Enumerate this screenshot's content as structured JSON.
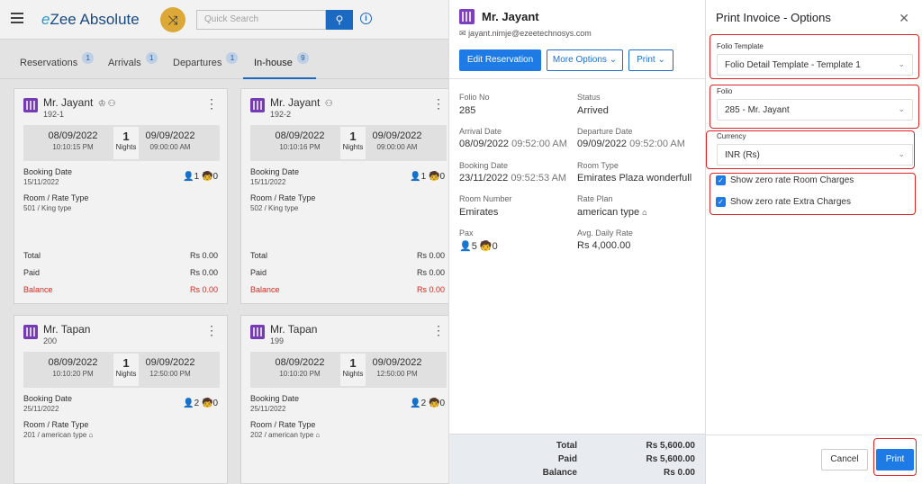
{
  "app": {
    "logo_prefix": "e",
    "logo_text": "Zee Absolute",
    "search_placeholder": "Quick Search"
  },
  "tabs": [
    {
      "label": "Reservations",
      "count": "1"
    },
    {
      "label": "Arrivals",
      "count": "1"
    },
    {
      "label": "Departures",
      "count": "1"
    },
    {
      "label": "In-house",
      "count": "9"
    }
  ],
  "cards": [
    {
      "name": "Mr. Jayant",
      "room": "192-1",
      "arr_date": "08/09/2022",
      "arr_time": "10:10:15 PM",
      "nights": "1",
      "nights_label": "Nights",
      "dep_date": "09/09/2022",
      "dep_time": "09:00:00 AM",
      "booking_label": "Booking Date",
      "booking_date": "15/11/2022",
      "pax": "1",
      "child": "0",
      "rate_label": "Room / Rate Type",
      "rate_type": "501 / King type",
      "total_label": "Total",
      "total": "Rs 0.00",
      "paid_label": "Paid",
      "paid": "Rs 0.00",
      "balance_label": "Balance",
      "balance": "Rs 0.00"
    },
    {
      "name": "Mr. Jayant",
      "room": "192-2",
      "arr_date": "08/09/2022",
      "arr_time": "10:10:16 PM",
      "nights": "1",
      "nights_label": "Nights",
      "dep_date": "09/09/2022",
      "dep_time": "09:00:00 AM",
      "booking_label": "Booking Date",
      "booking_date": "15/11/2022",
      "pax": "1",
      "child": "0",
      "rate_label": "Room / Rate Type",
      "rate_type": "502 / King type",
      "total_label": "Total",
      "total": "Rs 0.00",
      "paid_label": "Paid",
      "paid": "Rs 0.00",
      "balance_label": "Balance",
      "balance": "Rs 0.00"
    },
    {
      "name": "Mr. Tapan",
      "room": "200",
      "arr_date": "08/09/2022",
      "arr_time": "10:10:20 PM",
      "nights": "1",
      "nights_label": "Nights",
      "dep_date": "09/09/2022",
      "dep_time": "12:50:00 PM",
      "booking_label": "Booking Date",
      "booking_date": "25/11/2022",
      "pax": "2",
      "child": "0",
      "rate_label": "Room / Rate Type",
      "rate_type": "201 / american type"
    },
    {
      "name": "Mr. Tapan",
      "room": "199",
      "arr_date": "08/09/2022",
      "arr_time": "10:10:20 PM",
      "nights": "1",
      "nights_label": "Nights",
      "dep_date": "09/09/2022",
      "dep_time": "12:50:00 PM",
      "booking_label": "Booking Date",
      "booking_date": "25/11/2022",
      "pax": "2",
      "child": "0",
      "rate_label": "Room / Rate Type",
      "rate_type": "202 / american type"
    }
  ],
  "reservation": {
    "name": "Mr. Jayant",
    "email": "jayant.nimje@ezeetechnosys.com",
    "edit_label": "Edit Reservation",
    "more_label": "More Options",
    "print_label": "Print",
    "folio_no_label": "Folio No",
    "folio_no": "285",
    "status_label": "Status",
    "status": "Arrived",
    "arrival_label": "Arrival Date",
    "arrival_date": "08/09/2022",
    "arrival_time": "09:52:00 AM",
    "departure_label": "Departure Date",
    "departure_date": "09/09/2022",
    "departure_time": "09:52:00 AM",
    "booking_label": "Booking Date",
    "booking_date": "23/11/2022",
    "booking_time": "09:52:53 AM",
    "room_type_label": "Room Type",
    "room_type": "Emirates Plaza wonderfull",
    "room_number_label": "Room Number",
    "room_number": "Emirates",
    "rate_plan_label": "Rate Plan",
    "rate_plan": "american type",
    "pax_label": "Pax",
    "pax_adults": "5",
    "pax_children": "0",
    "adr_label": "Avg. Daily Rate",
    "adr": "Rs 4,000.00",
    "total_label": "Total",
    "total": "Rs 5,600.00",
    "paid_label": "Paid",
    "paid": "Rs 5,600.00",
    "balance_label": "Balance",
    "balance": "Rs 0.00"
  },
  "print_options": {
    "title": "Print Invoice - Options",
    "folio_template_label": "Folio Template",
    "folio_template": "Folio Detail Template - Template 1",
    "folio_label": "Folio",
    "folio": "285 - Mr. Jayant",
    "currency_label": "Currency",
    "currency": "INR (Rs)",
    "zero_room_label": "Show zero rate Room Charges",
    "zero_room_checked": true,
    "zero_extra_label": "Show zero rate Extra Charges",
    "zero_extra_checked": true,
    "cancel_label": "Cancel",
    "print_label": "Print"
  },
  "colors": {
    "primary": "#1e7be6",
    "highlight_frame": "#e02424",
    "balance_red": "#d93025",
    "room_icon": "#7b3fbf"
  }
}
